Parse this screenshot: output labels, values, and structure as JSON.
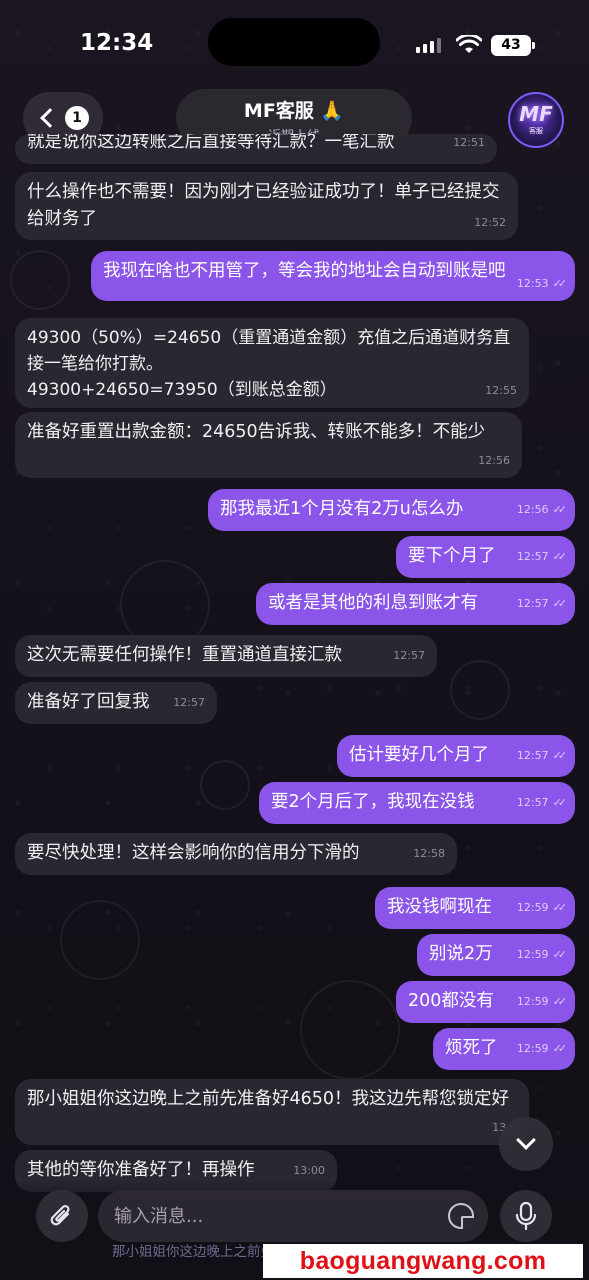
{
  "status": {
    "time": "12:34",
    "battery": "43"
  },
  "header": {
    "back_badge": "1",
    "title": "MF客服 🙏",
    "subtitle": "近期上线",
    "avatar_text": "MF",
    "avatar_sub": "客服"
  },
  "messages": [
    {
      "dir": "in",
      "text": "就是说你这边转账之后直接等待汇款？一笔汇款",
      "time": "12:51"
    },
    {
      "dir": "in",
      "text": "什么操作也不需要！因为刚才已经验证成功了！单子已经提交给财务了",
      "time": "12:52"
    },
    {
      "dir": "out",
      "text": "我现在啥也不用管了，等会我的地址会自动到账是吧",
      "time": "12:53"
    },
    {
      "dir": "in",
      "text": "49300（50%）=24650（重置通道金额）充值之后通道财务直接一笔给你打款。",
      "text2": "49300+24650=73950（到账总金额）",
      "time": "12:55"
    },
    {
      "dir": "in",
      "text": "准备好重置出款金额：24650告诉我、转账不能多！不能少",
      "time": "12:56"
    },
    {
      "dir": "out",
      "text": "那我最近1个月没有2万u怎么办",
      "time": "12:56"
    },
    {
      "dir": "out",
      "text": "要下个月了",
      "time": "12:57"
    },
    {
      "dir": "out",
      "text": "或者是其他的利息到账才有",
      "time": "12:57"
    },
    {
      "dir": "in",
      "text": "这次无需要任何操作！重置通道直接汇款",
      "time": "12:57"
    },
    {
      "dir": "in",
      "text": "准备好了回复我",
      "time": "12:57"
    },
    {
      "dir": "out",
      "text": "估计要好几个月了",
      "time": "12:57"
    },
    {
      "dir": "out",
      "text": "要2个月后了，我现在没钱",
      "time": "12:57"
    },
    {
      "dir": "in",
      "text": "要尽快处理！这样会影响你的信用分下滑的",
      "time": "12:58"
    },
    {
      "dir": "out",
      "text": "我没钱啊现在",
      "time": "12:59"
    },
    {
      "dir": "out",
      "text": "别说2万",
      "time": "12:59"
    },
    {
      "dir": "out",
      "text": "200都没有",
      "time": "12:59"
    },
    {
      "dir": "out",
      "text": "烦死了",
      "time": "12:59"
    },
    {
      "dir": "in",
      "text": "那小姐姐你这边晚上之前先准备好4650！我这边先帮您锁定好",
      "time": "13:0"
    },
    {
      "dir": "in",
      "text": "其他的等你准备好了！再操作",
      "time": "13:00"
    }
  ],
  "composer": {
    "placeholder": "输入消息...",
    "preview": "那小姐姐你这边晚上之前先准备好4650！我这边先帮您锁定好"
  },
  "watermark": "baoguangwang.com",
  "colors": {
    "outgoing": "#8c55ea",
    "incoming": "#2a2730",
    "watermark": "#e01018"
  }
}
